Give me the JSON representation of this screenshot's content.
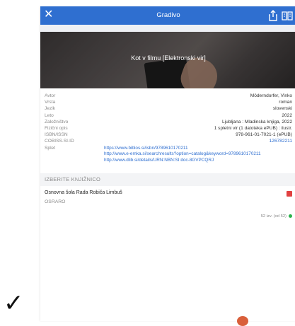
{
  "header": {
    "title": "Gradivo",
    "close_icon": "close-icon",
    "share_icon": "share-icon",
    "book_icon": "book-open-icon",
    "bg": "#2f6fd0"
  },
  "banner": {
    "title": "Kot v filmu [Elektronski vir]"
  },
  "details": [
    {
      "label": "Avtor",
      "value": "Möderndorfer, Vinko"
    },
    {
      "label": "Vrsta",
      "value": "roman"
    },
    {
      "label": "Jezik",
      "value": "slovenski"
    },
    {
      "label": "Leto",
      "value": "2022"
    },
    {
      "label": "Založništvo",
      "value": "Ljubljana : Mladinska knjiga, 2022"
    },
    {
      "label": "Fizični opis",
      "value": "1 spletni vir (1 datoteka ePUB) : ilustr."
    },
    {
      "label": "ISBN/ISSN",
      "value": "978-961-01-7021-1 (ePUB)"
    },
    {
      "label": "COBISS.SI-ID",
      "value": "126782211"
    }
  ],
  "splet": {
    "label": "Splet",
    "links": [
      "https://www.biblos.si/isbn/9789610170211",
      "http://www.e-emka.si/searchresults?option=catalog&keyword=9789610170211",
      "http://www.dlib.si/details/URN:NBN:SI:doc-8GVPCQRJ"
    ]
  },
  "section": {
    "title": "IZBERITE KNJIŽNICO"
  },
  "library": {
    "name": "Osnovna šola Rada Robiča Limbuš",
    "code": "OSRARO",
    "availability": "52 izv. (od 52)",
    "badge_color": "#e14040",
    "status_color": "#2bb24c"
  },
  "overlay": {
    "checkmark": "✓"
  }
}
